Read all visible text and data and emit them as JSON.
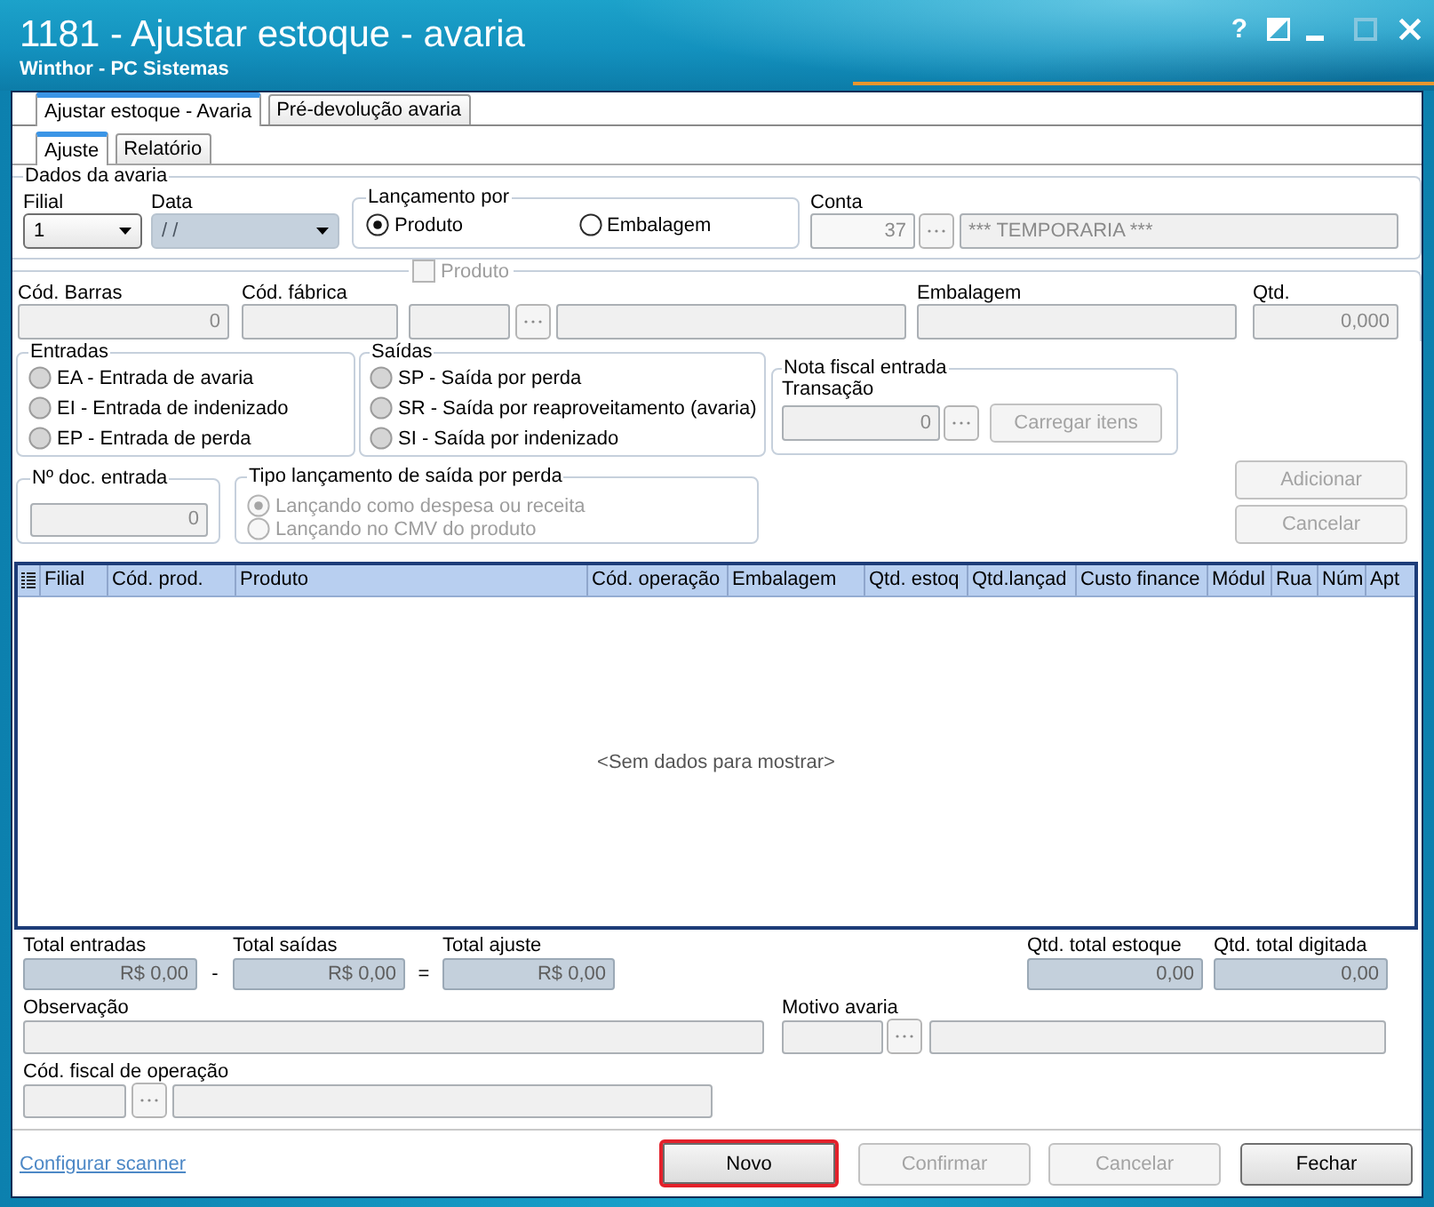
{
  "window": {
    "title": "1181 - Ajustar estoque - avaria",
    "subtitle": "Winthor - PC Sistemas",
    "controls": [
      {
        "kind": "help",
        "label": "?",
        "disabled": false
      },
      {
        "kind": "theme",
        "disabled": false
      },
      {
        "kind": "minimize",
        "disabled": false
      },
      {
        "kind": "maximize",
        "disabled": true
      },
      {
        "kind": "close",
        "disabled": false
      }
    ]
  },
  "tabs": [
    {
      "label": "Ajustar estoque - Avaria",
      "selected": true
    },
    {
      "label": "Pré-devolução avaria",
      "selected": false
    }
  ],
  "subtabs": [
    {
      "label": "Ajuste",
      "selected": true
    },
    {
      "label": "Relatório",
      "selected": false
    }
  ],
  "dados_avaria": {
    "title": "Dados da avaria",
    "filial": {
      "label": "Filial",
      "value": "1"
    },
    "data": {
      "label": "Data",
      "value": "/ /"
    },
    "lancamento_por": {
      "title": "Lançamento por",
      "options": [
        {
          "label": "Produto",
          "selected": true
        },
        {
          "label": "Embalagem",
          "selected": false
        }
      ]
    },
    "conta": {
      "label": "Conta",
      "code": "37",
      "name": "*** TEMPORARIA ***"
    }
  },
  "produto": {
    "barcode": {
      "label": "Cód. Barras",
      "value": "0"
    },
    "factory_code": {
      "label": "Cód. fábrica"
    },
    "product": {
      "label": "Produto",
      "checked": false,
      "disabled": true
    },
    "packaging": {
      "label": "Embalagem"
    },
    "quantity": {
      "label": "Qtd.",
      "value": "0,000"
    }
  },
  "entradas": {
    "title": "Entradas",
    "options": [
      {
        "label": "EA - Entrada de avaria",
        "selected": false
      },
      {
        "label": "EI - Entrada de indenizado",
        "selected": false
      },
      {
        "label": "EP - Entrada de perda",
        "selected": false
      }
    ]
  },
  "saidas": {
    "title": "Saídas",
    "options": [
      {
        "label": "SP - Saída por perda",
        "selected": false
      },
      {
        "label": "SR - Saída por reaproveitamento (avaria)",
        "selected": false
      },
      {
        "label": "SI - Saída por indenizado",
        "selected": false
      }
    ]
  },
  "nota_fiscal_entrada": {
    "title": "Nota fiscal entrada",
    "transacao": {
      "label": "Transação",
      "value": "0"
    },
    "load_button": {
      "label": "Carregar itens",
      "disabled": true
    }
  },
  "doc_entrada": {
    "title": "Nº doc. entrada",
    "value": "0"
  },
  "tipo_lancamento": {
    "title": "Tipo lançamento de saída por perda",
    "options": [
      {
        "label": "Lançando como despesa ou receita",
        "selected": true,
        "disabled": true
      },
      {
        "label": "Lançando no CMV do produto",
        "selected": false,
        "disabled": true
      }
    ]
  },
  "item_buttons": [
    {
      "label": "Adicionar",
      "disabled": true
    },
    {
      "label": "Cancelar",
      "disabled": true
    }
  ],
  "table": {
    "columns": [
      "Filial",
      "Cód. prod.",
      "Produto",
      "Cód. operação",
      "Embalagem",
      "Qtd. estoq",
      "Qtd.lançad",
      "Custo finance",
      "Módul",
      "Rua",
      "Núm",
      "Apt"
    ],
    "empty_message": "<Sem dados para mostrar>"
  },
  "totals": {
    "entradas": {
      "label": "Total entradas",
      "value": "R$ 0,00"
    },
    "minus": "-",
    "saidas": {
      "label": "Total saídas",
      "value": "R$ 0,00"
    },
    "equals": "=",
    "ajuste": {
      "label": "Total ajuste",
      "value": "R$ 0,00"
    },
    "qtd_estoque": {
      "label": "Qtd. total estoque",
      "value": "0,00"
    },
    "qtd_digitada": {
      "label": "Qtd. total digitada",
      "value": "0,00"
    }
  },
  "details": {
    "observacao": {
      "label": "Observação"
    },
    "motivo": {
      "label": "Motivo avaria"
    },
    "cfop": {
      "label": "Cód. fiscal de operação"
    }
  },
  "footer": {
    "link": "Configurar scanner",
    "buttons": [
      {
        "label": "Novo",
        "disabled": false,
        "highlighted": true
      },
      {
        "label": "Confirmar",
        "disabled": true,
        "highlighted": false
      },
      {
        "label": "Cancelar",
        "disabled": true,
        "highlighted": false
      },
      {
        "label": "Fechar",
        "disabled": false,
        "highlighted": false
      }
    ]
  }
}
